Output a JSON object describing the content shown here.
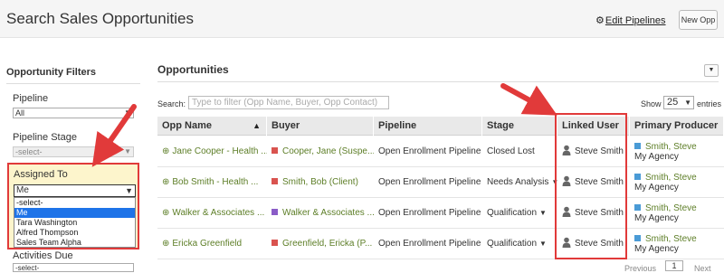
{
  "header": {
    "title": "Search Sales Opportunities",
    "edit_pipelines_label": "Edit Pipelines",
    "new_opp_label": "New Opp"
  },
  "sidebar": {
    "title": "Opportunity Filters",
    "pipeline": {
      "label": "Pipeline",
      "value": "All"
    },
    "pipeline_stage": {
      "label": "Pipeline Stage",
      "value": "-select-"
    },
    "assigned_to": {
      "label": "Assigned To",
      "value": "Me",
      "options": [
        "-select-",
        "Me",
        "Tara Washington",
        "Alfred Thompson",
        "Sales Team Alpha"
      ],
      "selected_option": "Me"
    },
    "activities_due": {
      "label": "Activities Due",
      "value": "-select-"
    }
  },
  "main": {
    "title": "Opportunities",
    "search": {
      "label": "Search:",
      "placeholder": "Type to filter (Opp Name, Buyer, Opp Contact)"
    },
    "show": {
      "label": "Show",
      "value": "25",
      "suffix": "entries"
    },
    "table": {
      "columns": [
        "Opp Name",
        "Buyer",
        "Pipeline",
        "Stage",
        "Linked User",
        "Primary Producer"
      ],
      "rows": [
        {
          "opp_name": "Jane Cooper - Health ...",
          "buyer": "Cooper, Jane (Suspe...",
          "buyer_color": "#d9534f",
          "pipeline": "Open Enrollment Pipeline",
          "stage": "Closed Lost",
          "stage_dropdown": false,
          "linked_user": "Steve Smith",
          "producer_name": "Smith, Steve",
          "producer_agency": "My Agency"
        },
        {
          "opp_name": "Bob Smith - Health ...",
          "buyer": "Smith, Bob (Client)",
          "buyer_color": "#d9534f",
          "pipeline": "Open Enrollment Pipeline",
          "stage": "Needs Analysis",
          "stage_dropdown": true,
          "linked_user": "Steve Smith",
          "producer_name": "Smith, Steve",
          "producer_agency": "My Agency"
        },
        {
          "opp_name": "Walker & Associates ...",
          "buyer": "Walker & Associates ...",
          "buyer_color": "#8a5cc7",
          "pipeline": "Open Enrollment Pipeline",
          "stage": "Qualification",
          "stage_dropdown": true,
          "linked_user": "Steve Smith",
          "producer_name": "Smith, Steve",
          "producer_agency": "My Agency"
        },
        {
          "opp_name": "Ericka Greenfield",
          "buyer": "Greenfield, Ericka (P...",
          "buyer_color": "#d9534f",
          "pipeline": "Open Enrollment Pipeline",
          "stage": "Qualification",
          "stage_dropdown": true,
          "linked_user": "Steve Smith",
          "producer_name": "Smith, Steve",
          "producer_agency": "My Agency"
        }
      ]
    },
    "pagination": {
      "previous": "Previous",
      "page": "1",
      "next": "Next"
    }
  },
  "colors": {
    "accent_green": "#5d7e27",
    "highlight_red": "#e13a3a",
    "highlight_yellow": "#fdf5cc",
    "selected_blue": "#1e73e8",
    "producer_swatch": "#4a9bd6"
  }
}
